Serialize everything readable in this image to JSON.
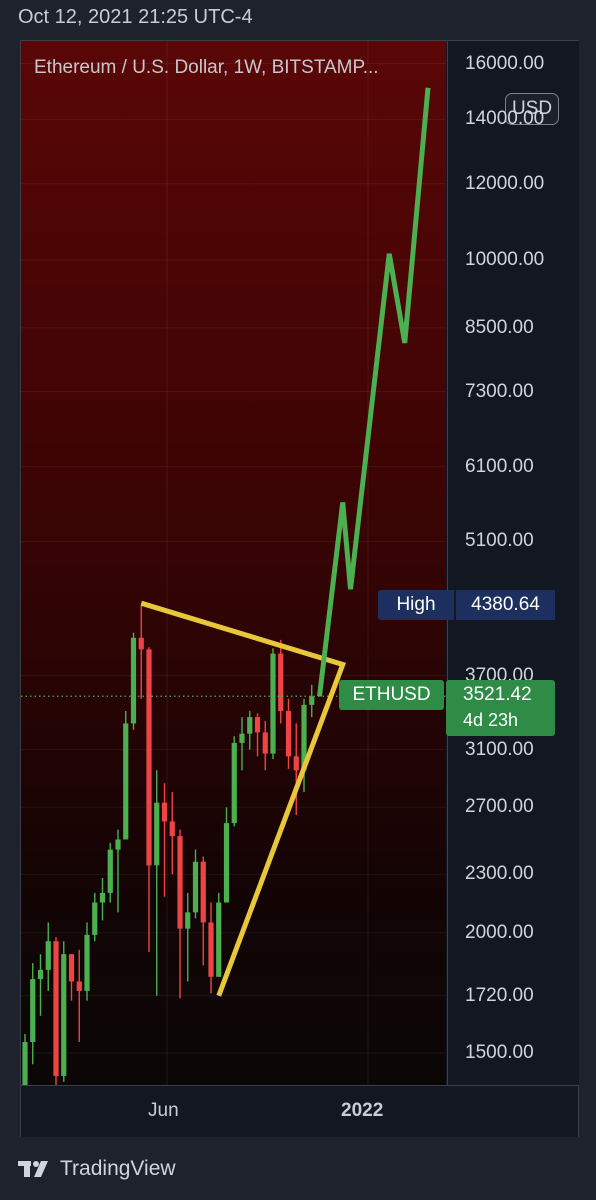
{
  "timestamp": "Oct 12, 2021 21:25 UTC-4",
  "symbol_title": "Ethereum / U.S. Dollar, 1W, BITSTAMP...",
  "currency_button": "USD",
  "brand": "TradingView",
  "high_label": {
    "name": "High",
    "value": "4380.64"
  },
  "symbol_label": {
    "name": "ETHUSD",
    "value": "3521.42",
    "countdown": "4d 23h"
  },
  "colors": {
    "up": "#4caf50",
    "down": "#ef4444",
    "projection": "#4caf50",
    "triangle": "#e8c83a",
    "price_line": "#4caf50"
  },
  "chart_data": {
    "type": "candlestick",
    "title": "Ethereum / U.S. Dollar, 1W, BITSTAMP...",
    "price_scale": "log",
    "y_ticks": [
      "16000.00",
      "14000.00",
      "12000.00",
      "10000.00",
      "8500.00",
      "7300.00",
      "6100.00",
      "5100.00",
      "3700.00",
      "3100.00",
      "2700.00",
      "2300.00",
      "2000.00",
      "1720.00",
      "1500.00"
    ],
    "x_ticks": [
      "Jun",
      "2022"
    ],
    "current_price": 3521.42,
    "high": 4380.64,
    "candles": [
      {
        "o": 1380,
        "h": 1570,
        "l": 1330,
        "c": 1540
      },
      {
        "o": 1540,
        "h": 1860,
        "l": 1460,
        "c": 1790
      },
      {
        "o": 1790,
        "h": 1900,
        "l": 1640,
        "c": 1830
      },
      {
        "o": 1830,
        "h": 2050,
        "l": 1740,
        "c": 1960
      },
      {
        "o": 1960,
        "h": 1980,
        "l": 1380,
        "c": 1420
      },
      {
        "o": 1420,
        "h": 1960,
        "l": 1400,
        "c": 1900
      },
      {
        "o": 1900,
        "h": 1900,
        "l": 1700,
        "c": 1780
      },
      {
        "o": 1780,
        "h": 1920,
        "l": 1540,
        "c": 1740
      },
      {
        "o": 1740,
        "h": 2050,
        "l": 1700,
        "c": 1990
      },
      {
        "o": 1990,
        "h": 2200,
        "l": 1960,
        "c": 2150
      },
      {
        "o": 2150,
        "h": 2280,
        "l": 2060,
        "c": 2200
      },
      {
        "o": 2200,
        "h": 2480,
        "l": 2150,
        "c": 2440
      },
      {
        "o": 2440,
        "h": 2560,
        "l": 2100,
        "c": 2500
      },
      {
        "o": 2500,
        "h": 3400,
        "l": 2500,
        "c": 3300
      },
      {
        "o": 3300,
        "h": 4100,
        "l": 3250,
        "c": 4050
      },
      {
        "o": 4050,
        "h": 4380,
        "l": 3500,
        "c": 3940
      },
      {
        "o": 3940,
        "h": 3960,
        "l": 1910,
        "c": 2350
      },
      {
        "o": 2350,
        "h": 2950,
        "l": 1720,
        "c": 2730
      },
      {
        "o": 2730,
        "h": 2860,
        "l": 2180,
        "c": 2610
      },
      {
        "o": 2610,
        "h": 2800,
        "l": 2300,
        "c": 2520
      },
      {
        "o": 2520,
        "h": 2560,
        "l": 1710,
        "c": 2020
      },
      {
        "o": 2020,
        "h": 2200,
        "l": 1780,
        "c": 2100
      },
      {
        "o": 2100,
        "h": 2440,
        "l": 2070,
        "c": 2370
      },
      {
        "o": 2370,
        "h": 2400,
        "l": 1850,
        "c": 2050
      },
      {
        "o": 2050,
        "h": 2150,
        "l": 1730,
        "c": 1800
      },
      {
        "o": 1800,
        "h": 2200,
        "l": 1800,
        "c": 2150
      },
      {
        "o": 2150,
        "h": 2700,
        "l": 2150,
        "c": 2600
      },
      {
        "o": 2600,
        "h": 3200,
        "l": 2580,
        "c": 3150
      },
      {
        "o": 3150,
        "h": 3350,
        "l": 2950,
        "c": 3220
      },
      {
        "o": 3220,
        "h": 3400,
        "l": 3100,
        "c": 3350
      },
      {
        "o": 3350,
        "h": 3380,
        "l": 3050,
        "c": 3230
      },
      {
        "o": 3230,
        "h": 3320,
        "l": 2950,
        "c": 3070
      },
      {
        "o": 3070,
        "h": 3950,
        "l": 3030,
        "c": 3900
      },
      {
        "o": 3900,
        "h": 4030,
        "l": 3300,
        "c": 3400
      },
      {
        "o": 3400,
        "h": 3500,
        "l": 2960,
        "c": 3050
      },
      {
        "o": 3050,
        "h": 3300,
        "l": 2650,
        "c": 2950
      },
      {
        "o": 2950,
        "h": 3500,
        "l": 2800,
        "c": 3450
      },
      {
        "o": 3450,
        "h": 3620,
        "l": 3350,
        "c": 3521
      }
    ],
    "projection": [
      {
        "week": 38,
        "price": 3521
      },
      {
        "week": 41,
        "price": 5600
      },
      {
        "week": 42,
        "price": 4550
      },
      {
        "week": 47,
        "price": 10150
      },
      {
        "week": 49,
        "price": 8200
      },
      {
        "week": 52,
        "price": 15100
      }
    ],
    "triangle": [
      {
        "week": 15,
        "price": 4400
      },
      {
        "week": 41,
        "price": 3800
      },
      {
        "week": 25,
        "price": 1720
      },
      {
        "week": 41,
        "price": 3800
      }
    ]
  }
}
